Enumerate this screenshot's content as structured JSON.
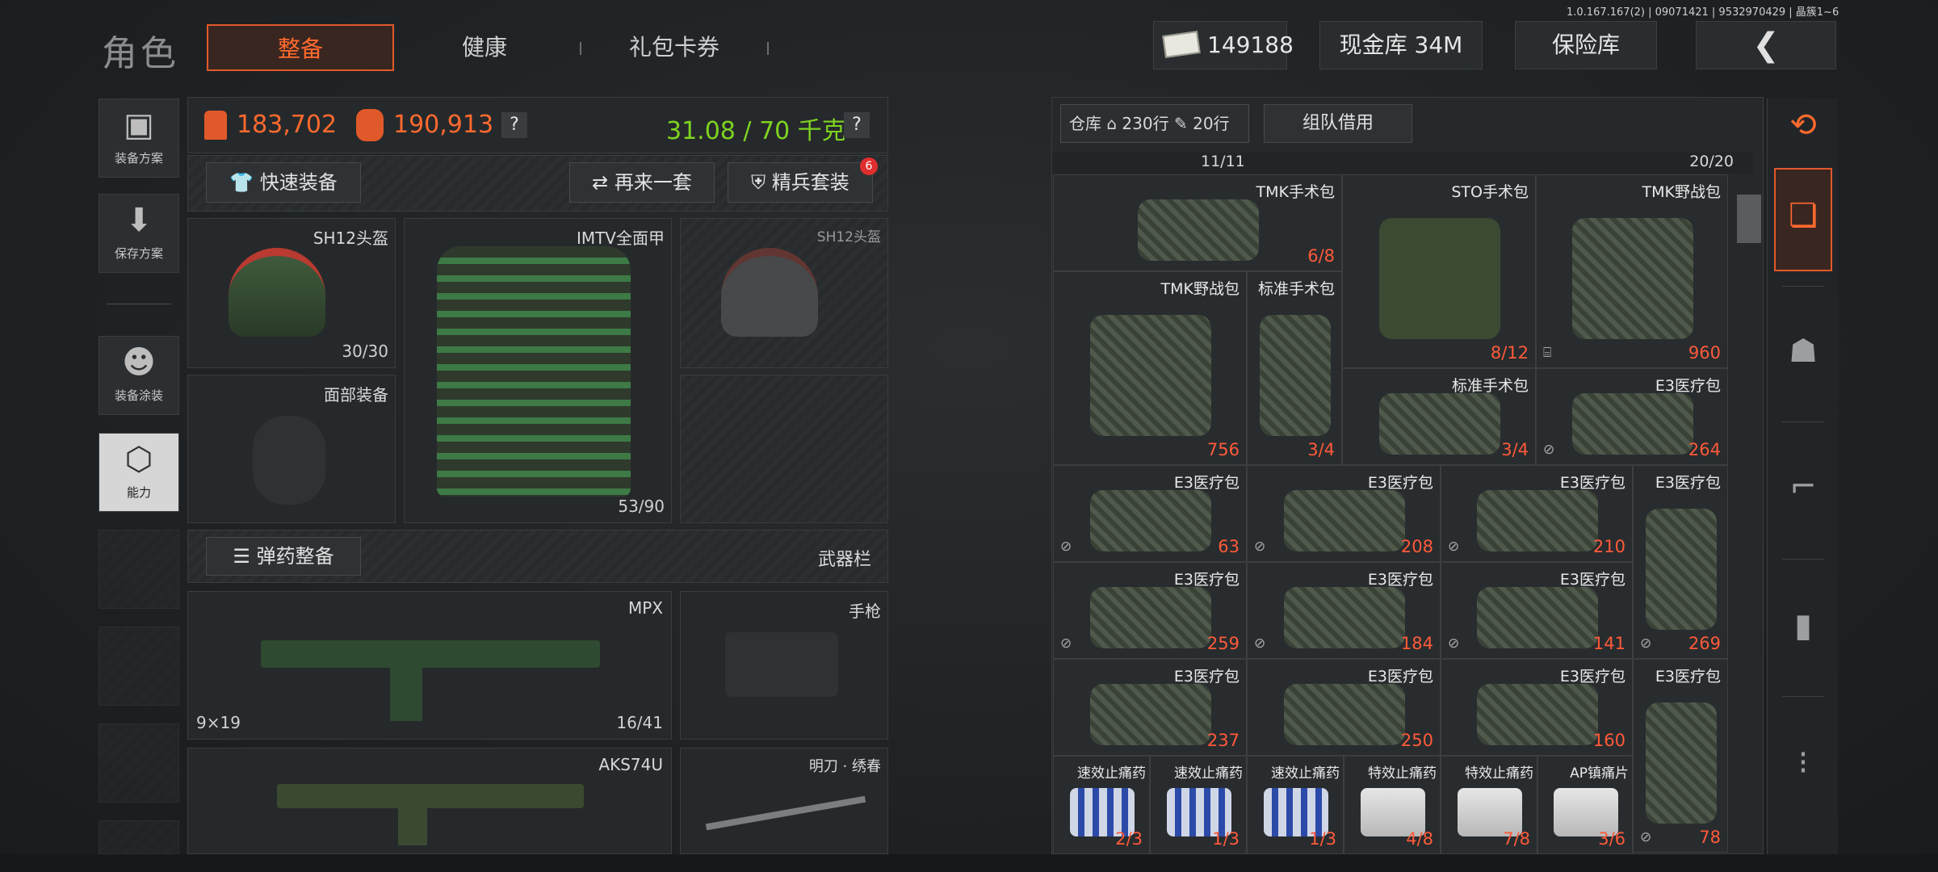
{
  "version": "1.0.167.167(2) | 09071421 | 9532970429 | 晶簇1~6",
  "header": {
    "title": "角色",
    "tabs": [
      {
        "label": "整备",
        "active": true
      },
      {
        "label": "健康"
      },
      {
        "label": "礼包卡券"
      }
    ],
    "money": "149188",
    "cash_vault": "现金库 34M",
    "safe_box": "保险库",
    "back_icon": "chevron-left-icon"
  },
  "sidebar": {
    "items": [
      {
        "label": "装备方案",
        "icon": "vest-icon"
      },
      {
        "label": "保存方案",
        "icon": "download-icon"
      },
      {
        "label": "装备涂装",
        "icon": "paint-icon"
      },
      {
        "label": "能力",
        "icon": "ability-icon"
      }
    ]
  },
  "stats": {
    "armor_value": "183,702",
    "bag_value": "190,913",
    "weight": "31.08 / 70 千克",
    "help": "?"
  },
  "loadout": {
    "quick_equip": "快速装备",
    "again": "再来一套",
    "elite": "精兵套装",
    "elite_badge": "6",
    "slots": {
      "helmet": {
        "name": "SH12头盔",
        "dur": "30/30"
      },
      "armor": {
        "name": "IMTV全面甲",
        "dur": "53/90"
      },
      "helmet_ghost": {
        "name": "SH12头盔"
      },
      "face": {
        "name": "面部装备"
      }
    },
    "ammo": "弹药整备",
    "weapon_bar": "武器栏",
    "weapons": [
      {
        "name": "MPX",
        "caliber": "9×19",
        "ammo": "16/41"
      },
      {
        "name": "手枪"
      },
      {
        "name": "AKS74U"
      },
      {
        "name": "明刀 · 绣春"
      }
    ]
  },
  "inventory": {
    "warehouse": "仓库",
    "rows": "230行",
    "bag_rows": "20行",
    "team_borrow": "组队借用",
    "left_cap": "11/11",
    "right_cap": "20/20",
    "items": [
      {
        "name": "TMK手术包",
        "count": "6/8"
      },
      {
        "name": "STO手术包",
        "count": "8/12"
      },
      {
        "name": "TMK野战包",
        "count": "960"
      },
      {
        "name": "TMK野战包",
        "count": "756"
      },
      {
        "name": "标准手术包",
        "count": "3/4"
      },
      {
        "name": "标准手术包",
        "count": "3/4"
      },
      {
        "name": "E3医疗包",
        "count": "264"
      },
      {
        "name": "E3医疗包",
        "count": "63"
      },
      {
        "name": "E3医疗包",
        "count": "208"
      },
      {
        "name": "E3医疗包",
        "count": "210"
      },
      {
        "name": "E3医疗包",
        "count": "269"
      },
      {
        "name": "E3医疗包",
        "count": "259"
      },
      {
        "name": "E3医疗包",
        "count": "184"
      },
      {
        "name": "E3医疗包",
        "count": "141"
      },
      {
        "name": "E3医疗包",
        "count": "237"
      },
      {
        "name": "E3医疗包",
        "count": "250"
      },
      {
        "name": "E3医疗包",
        "count": "160"
      },
      {
        "name": "E3医疗包",
        "count": "78"
      },
      {
        "name": "速效止痛药",
        "count": "2/3"
      },
      {
        "name": "速效止痛药",
        "count": "1/3"
      },
      {
        "name": "速效止痛药",
        "count": "1/3"
      },
      {
        "name": "特效止痛药",
        "count": "4/8"
      },
      {
        "name": "特效止痛药",
        "count": "7/8"
      },
      {
        "name": "AP镇痛片",
        "count": "3/6"
      }
    ]
  },
  "colors": {
    "accent": "#ff6a2e",
    "weight_green": "#7ed321",
    "count_red": "#ff5a3a"
  }
}
